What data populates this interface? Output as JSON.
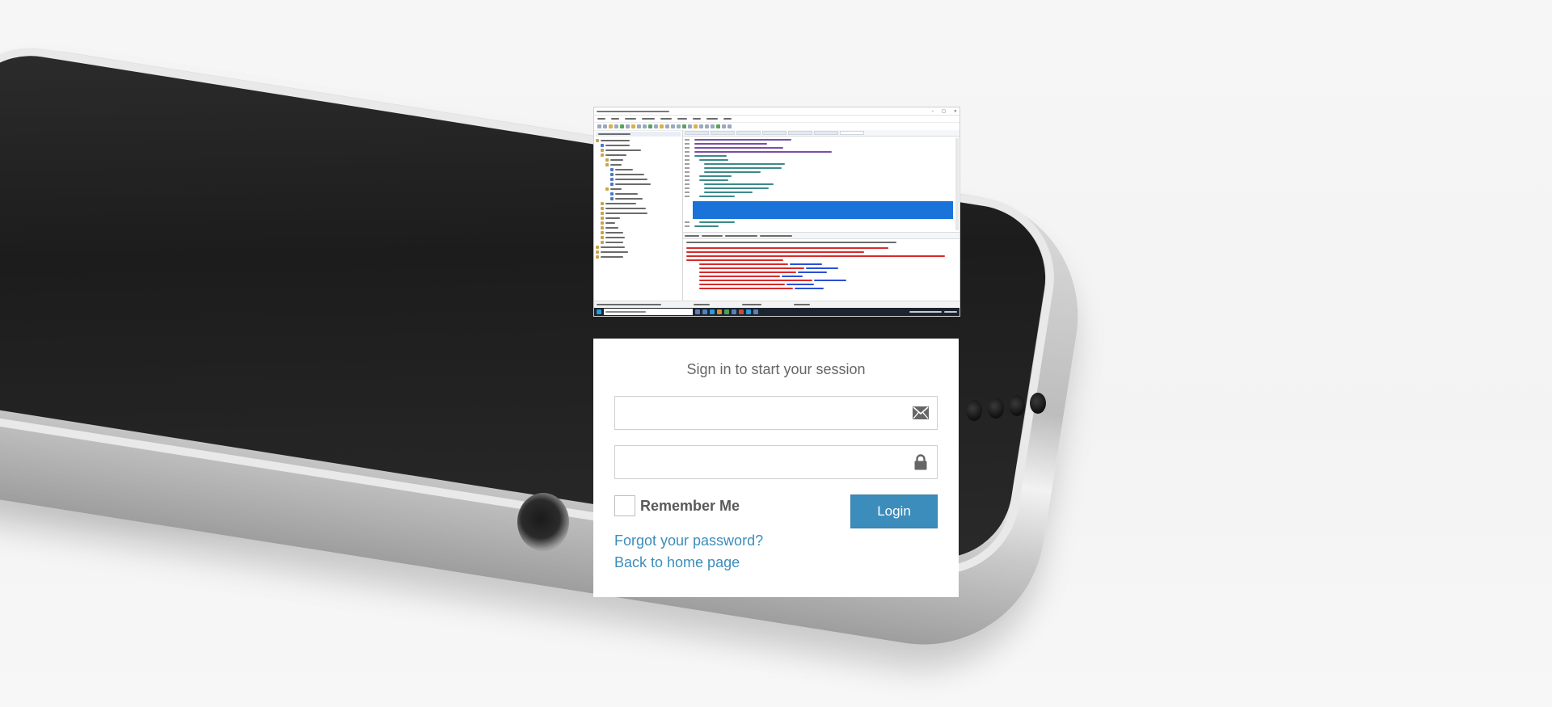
{
  "login": {
    "message": "Sign in to start your session",
    "email_placeholder": "",
    "password_placeholder": "",
    "remember_label": "Remember Me",
    "login_label": "Login",
    "forgot_link": "Forgot your password?",
    "home_link": "Back to home page"
  },
  "colors": {
    "accent": "#3c8dbc",
    "link": "#3c8dbc",
    "text_muted": "#666666"
  },
  "icons": {
    "email": "envelope-icon",
    "password": "lock-icon"
  }
}
